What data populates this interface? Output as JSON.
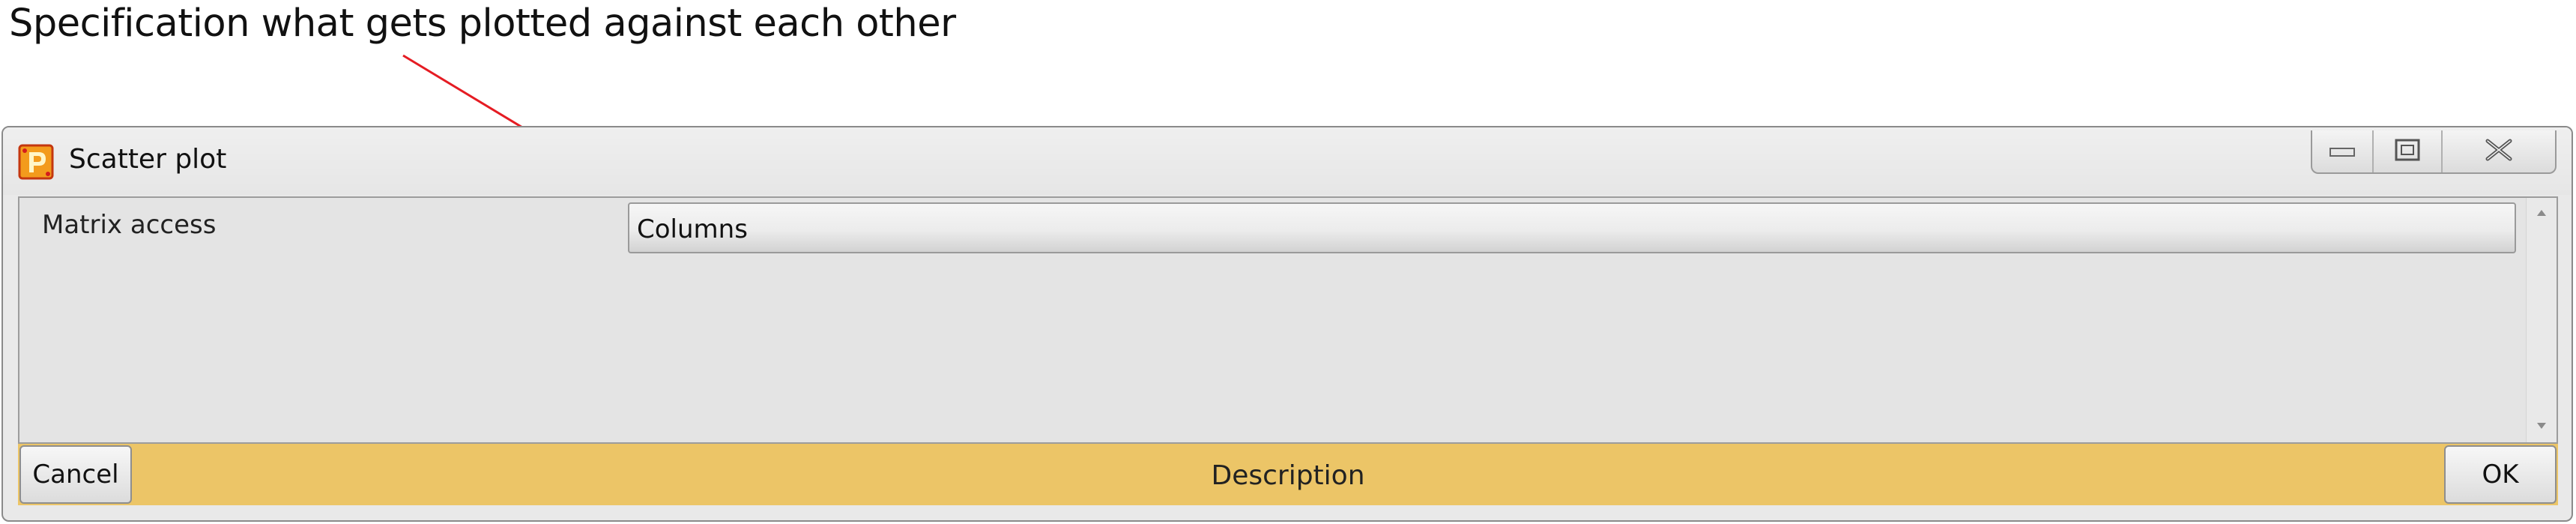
{
  "annotation": {
    "text": "Specification what gets plotted against each other",
    "arrow_color": "#e51c23"
  },
  "window": {
    "title": "Scatter plot",
    "icon": "app-logo-icon",
    "controls": [
      "minimize-icon",
      "maximize-icon",
      "close-icon"
    ]
  },
  "properties": [
    {
      "label": "Matrix access",
      "value": "Columns"
    }
  ],
  "footer": {
    "cancel_label": "Cancel",
    "description": "Description",
    "ok_label": "OK",
    "color": "#ecc567"
  }
}
